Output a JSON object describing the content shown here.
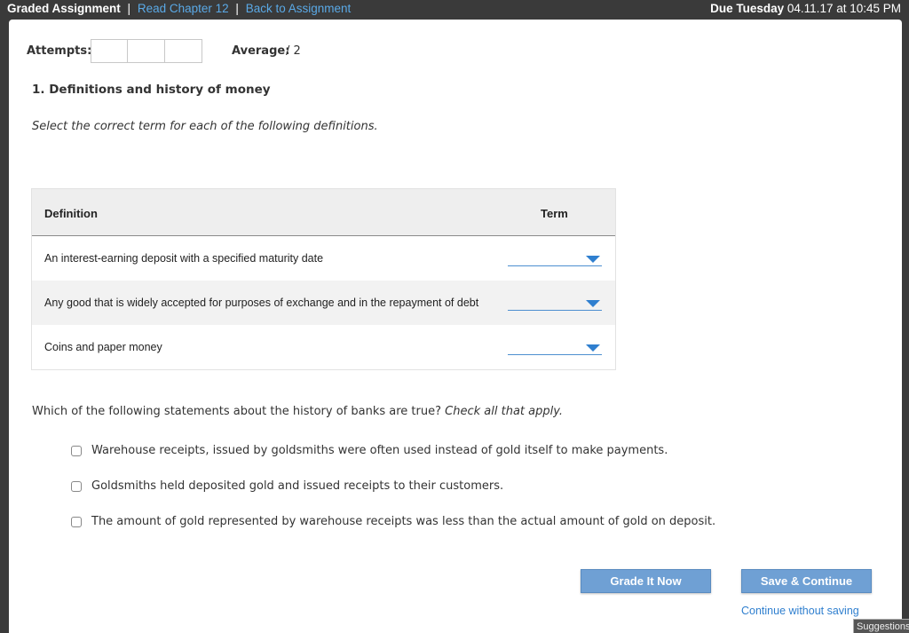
{
  "topbar": {
    "title": "Graded Assignment",
    "sep1": "|",
    "link_read": "Read Chapter 12",
    "sep2": "|",
    "link_back": "Back to Assignment",
    "due_bold": "Due Tuesday",
    "due_rest": "04.11.17 at 10:45 PM"
  },
  "header": {
    "attempts_label": "Attempts:",
    "average_label": "Average:",
    "average_value": "/ 2"
  },
  "question": {
    "title": "1. Definitions and history of money",
    "instructions": "Select the correct term for each of the following definitions."
  },
  "table": {
    "col_definition": "Definition",
    "col_term": "Term",
    "rows": [
      {
        "definition": "An interest-earning deposit with a specified maturity date",
        "term": ""
      },
      {
        "definition": "Any good that is widely accepted for purposes of exchange and in the repayment of debt",
        "term": ""
      },
      {
        "definition": "Coins and paper money",
        "term": ""
      }
    ]
  },
  "question2": {
    "prompt": "Which of the following statements about the history of banks are true?",
    "hint": "Check all that apply.",
    "options": [
      "Warehouse receipts, issued by goldsmiths were often used instead of gold itself to make payments.",
      "Goldsmiths held deposited gold and issued receipts to their customers.",
      "The amount of gold represented by warehouse receipts was less than the actual amount of gold on deposit."
    ]
  },
  "actions": {
    "grade_label": "Grade It Now",
    "save_label": "Save & Continue",
    "continue_label": "Continue without saving",
    "suggestions_label": "Suggestions"
  },
  "colors": {
    "topbar_bg": "#3a3a3a",
    "link": "#5aa9e6",
    "button_bg": "#6fa0d4",
    "dropdown_accent": "#2f7fcf"
  }
}
